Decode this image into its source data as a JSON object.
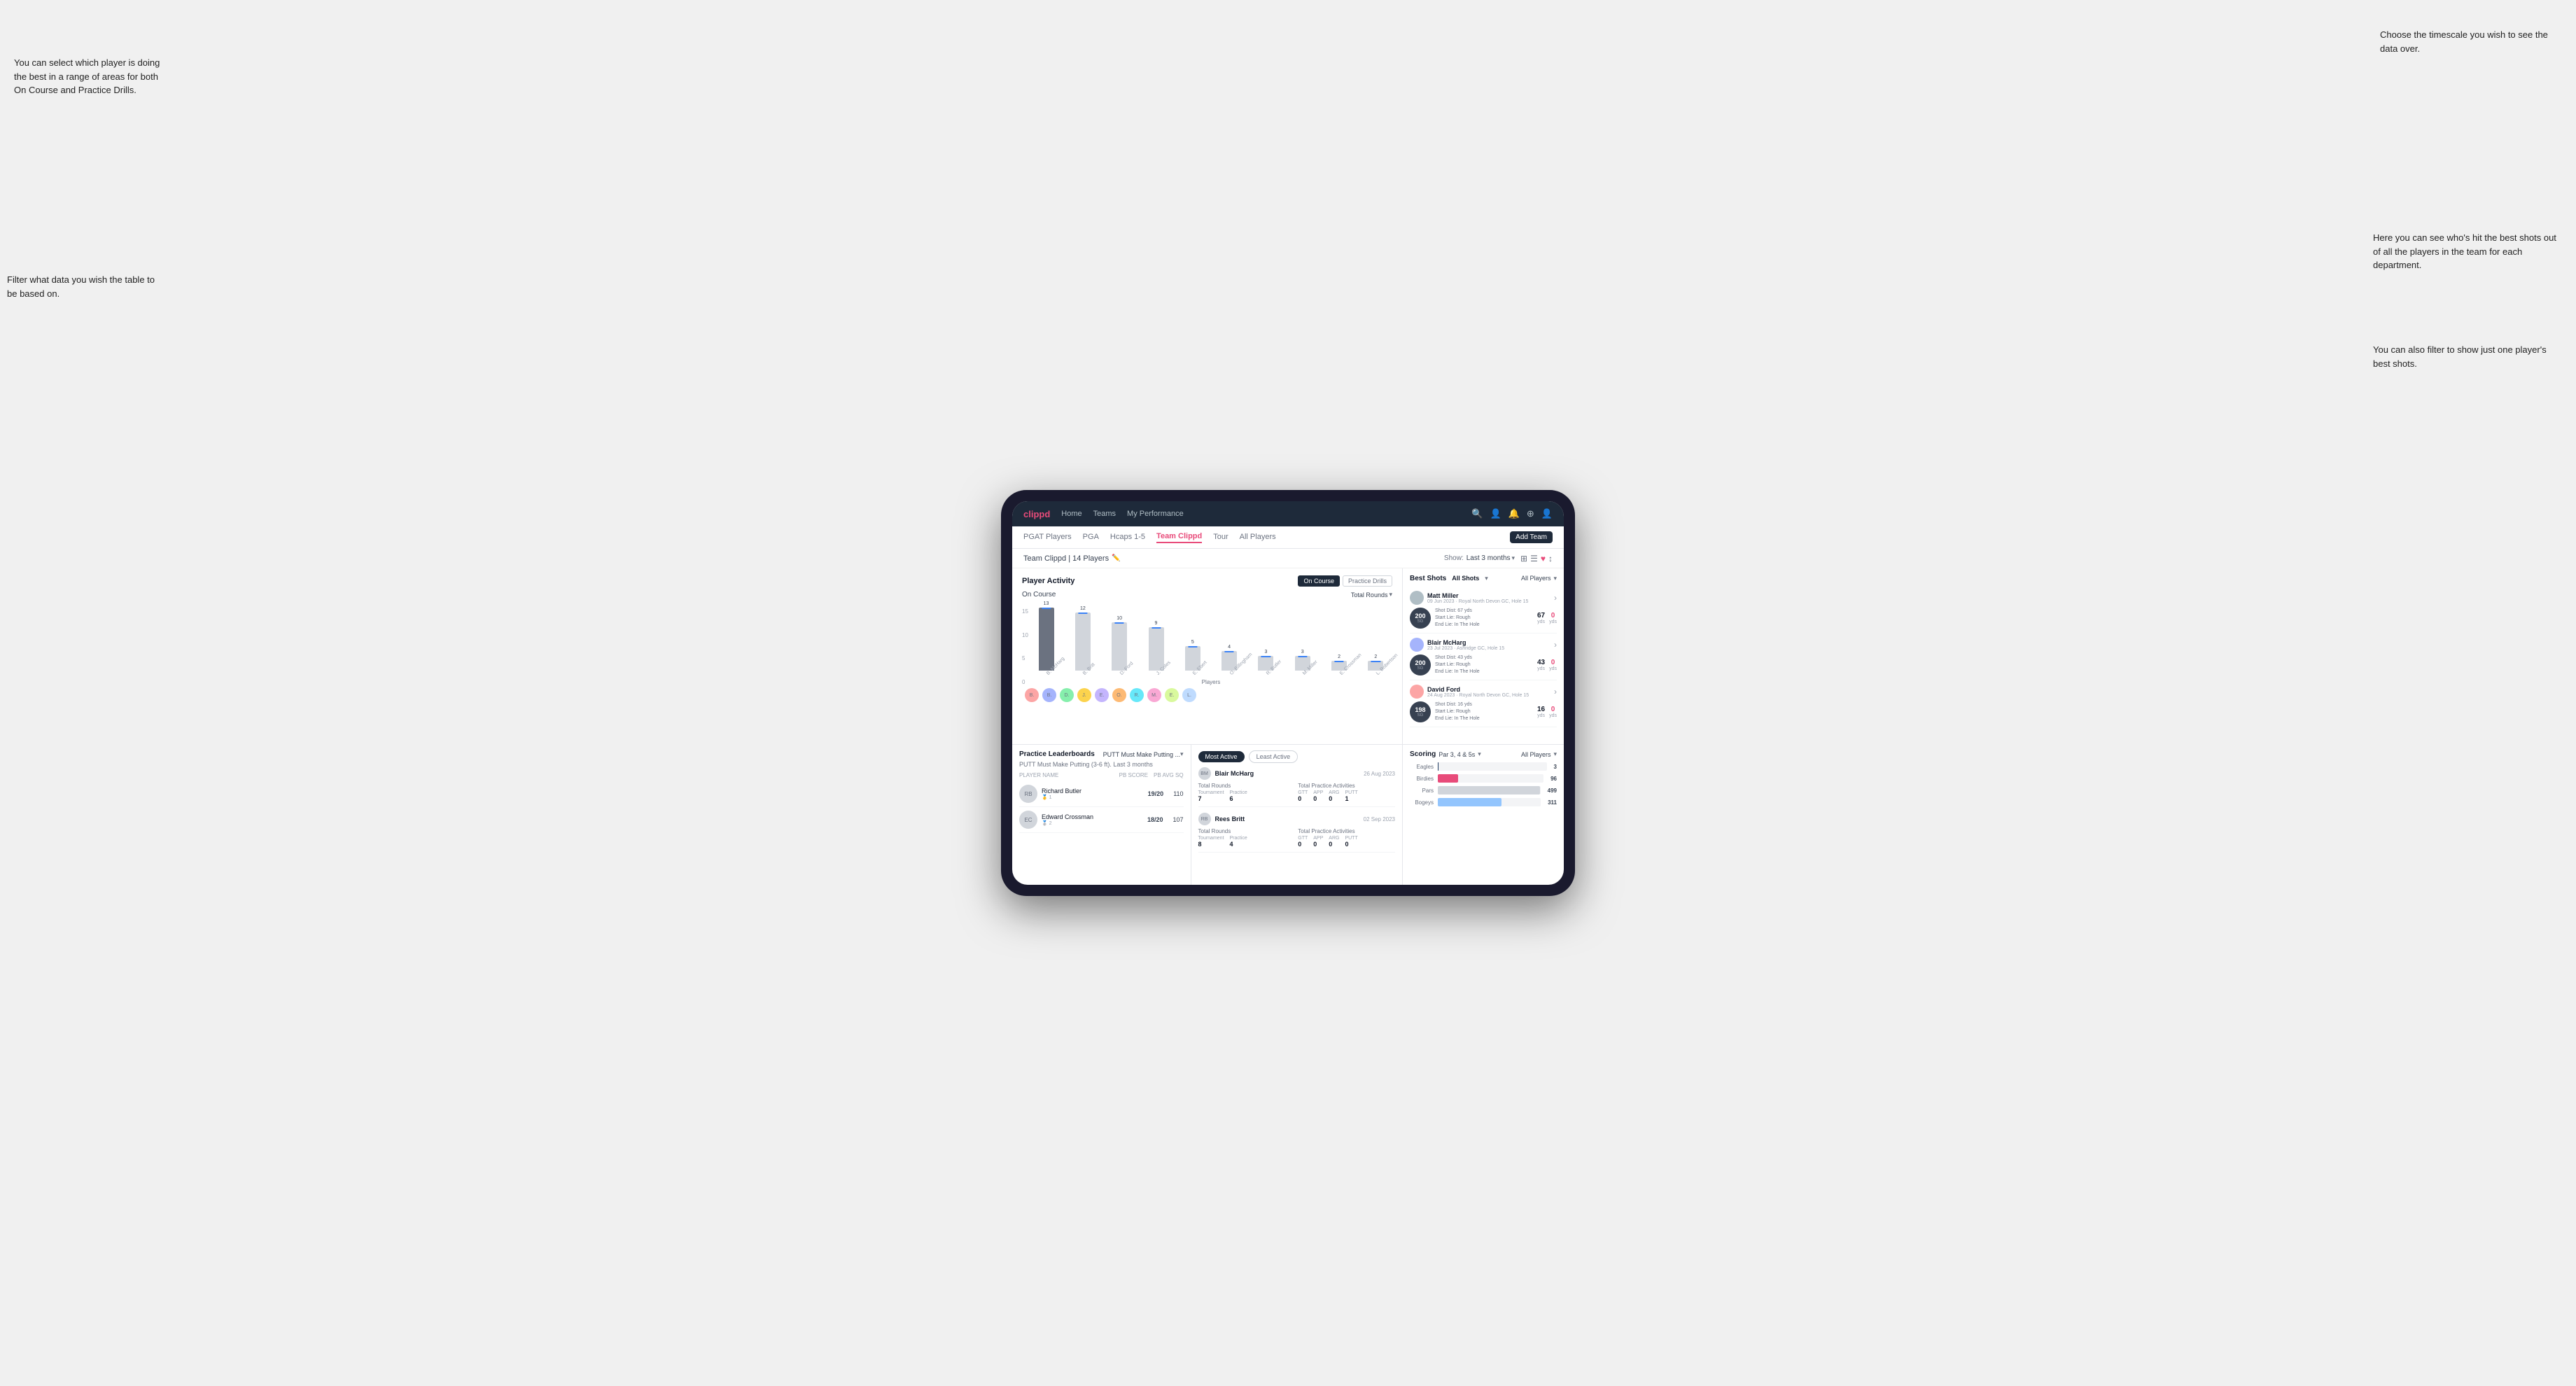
{
  "annotations": {
    "top_left": "You can select which player is doing the best in a range of areas for both On Course and Practice Drills.",
    "top_right": "Choose the timescale you wish to see the data over.",
    "mid_left": "Filter what data you wish the table to be based on.",
    "mid_right": "Here you can see who's hit the best shots out of all the players in the team for each department.",
    "bot_right": "You can also filter to show just one player's best shots."
  },
  "nav": {
    "logo": "clippd",
    "items": [
      "Home",
      "Teams",
      "My Performance"
    ],
    "icons": [
      "🔍",
      "👤",
      "🔔",
      "⊕",
      "👤"
    ]
  },
  "sub_tabs": {
    "items": [
      "PGAT Players",
      "PGA",
      "Hcaps 1-5",
      "Team Clippd",
      "Tour",
      "All Players"
    ],
    "active": "Team Clippd",
    "add_btn": "Add Team"
  },
  "team_header": {
    "title": "Team Clippd | 14 Players",
    "show_label": "Show:",
    "time_filter": "Last 3 months",
    "view_icons": [
      "⊞",
      "⊟",
      "♥",
      "↕"
    ]
  },
  "activity": {
    "title": "Player Activity",
    "toggle_options": [
      "On Course",
      "Practice Drills"
    ],
    "active_toggle": "On Course",
    "sub_title": "On Course",
    "chart_filter": "Total Rounds",
    "y_axis": [
      "15",
      "10",
      "5",
      "0"
    ],
    "bars": [
      {
        "label": "13",
        "height": 90,
        "name": "B. McHarg",
        "highlighted": true
      },
      {
        "label": "12",
        "height": 83,
        "name": "B. Britt",
        "highlighted": false
      },
      {
        "label": "10",
        "height": 69,
        "name": "D. Ford",
        "highlighted": false
      },
      {
        "label": "9",
        "height": 62,
        "name": "J. Coles",
        "highlighted": false
      },
      {
        "label": "5",
        "height": 35,
        "name": "E. Ebert",
        "highlighted": false
      },
      {
        "label": "4",
        "height": 28,
        "name": "O. Billingham",
        "highlighted": false
      },
      {
        "label": "3",
        "height": 21,
        "name": "R. Butler",
        "highlighted": false
      },
      {
        "label": "3",
        "height": 21,
        "name": "M. Miller",
        "highlighted": false
      },
      {
        "label": "2",
        "height": 14,
        "name": "E. Crossman",
        "highlighted": false
      },
      {
        "label": "2",
        "height": 14,
        "name": "L. Robertson",
        "highlighted": false
      }
    ],
    "x_label": "Players"
  },
  "practice": {
    "title": "Practice Leaderboards",
    "dropdown": "PUTT Must Make Putting ...",
    "sub_title": "PUTT Must Make Putting (3-6 ft). Last 3 months",
    "cols": [
      "Player Name",
      "PB Score",
      "PB Avg SQ"
    ],
    "players": [
      {
        "name": "Richard Butler",
        "rank": "1",
        "score": "19/20",
        "avg": "110",
        "medal": "🥇"
      },
      {
        "name": "Edward Crossman",
        "rank": "2",
        "score": "18/20",
        "avg": "107",
        "medal": "🥈"
      }
    ]
  },
  "most_active": {
    "tabs": [
      "Most Active",
      "Least Active"
    ],
    "active_tab": "Most Active",
    "players": [
      {
        "name": "Blair McHarg",
        "date": "26 Aug 2023",
        "total_rounds_label": "Total Rounds",
        "tournament": "7",
        "practice": "6",
        "total_practice_label": "Total Practice Activities",
        "gtt": "0",
        "app": "0",
        "arg": "0",
        "putt": "1"
      },
      {
        "name": "Rees Britt",
        "date": "02 Sep 2023",
        "total_rounds_label": "Total Rounds",
        "tournament": "8",
        "practice": "4",
        "total_practice_label": "Total Practice Activities",
        "gtt": "0",
        "app": "0",
        "arg": "0",
        "putt": "0"
      }
    ]
  },
  "best_shots": {
    "title": "Best Shots",
    "tabs": [
      "All Shots",
      "All Players"
    ],
    "shots": [
      {
        "player": "Matt Miller",
        "meta": "09 Jun 2023 · Royal North Devon GC, Hole 15",
        "badge": "200",
        "sg_label": "SG",
        "info": "Shot Dist: 67 yds\nStart Lie: Rough\nEnd Lie: In The Hole",
        "metric1": "67",
        "unit1": "yds",
        "metric2": "0",
        "unit2": "yds"
      },
      {
        "player": "Blair McHarg",
        "meta": "23 Jul 2023 · Ashridge GC, Hole 15",
        "badge": "200",
        "sg_label": "SG",
        "info": "Shot Dist: 43 yds\nStart Lie: Rough\nEnd Lie: In The Hole",
        "metric1": "43",
        "unit1": "yds",
        "metric2": "0",
        "unit2": "yds"
      },
      {
        "player": "David Ford",
        "meta": "24 Aug 2023 · Royal North Devon GC, Hole 15",
        "badge": "198",
        "sg_label": "SG",
        "info": "Shot Dist: 16 yds\nStart Lie: Rough\nEnd Lie: In The Hole",
        "metric1": "16",
        "unit1": "yds",
        "metric2": "0",
        "unit2": "yds"
      }
    ]
  },
  "scoring": {
    "title": "Scoring",
    "filter": "Par 3, 4 & 5s",
    "player_filter": "All Players",
    "rows": [
      {
        "label": "Eagles",
        "value": 3,
        "max": 500,
        "color": "#1e3a5f"
      },
      {
        "label": "Birdies",
        "value": 96,
        "max": 500,
        "color": "#e84b7a"
      },
      {
        "label": "Pars",
        "value": 499,
        "max": 500,
        "color": "#6b7280"
      },
      {
        "label": "Bogeys",
        "value": 311,
        "max": 500,
        "color": "#93c5fd"
      }
    ]
  }
}
